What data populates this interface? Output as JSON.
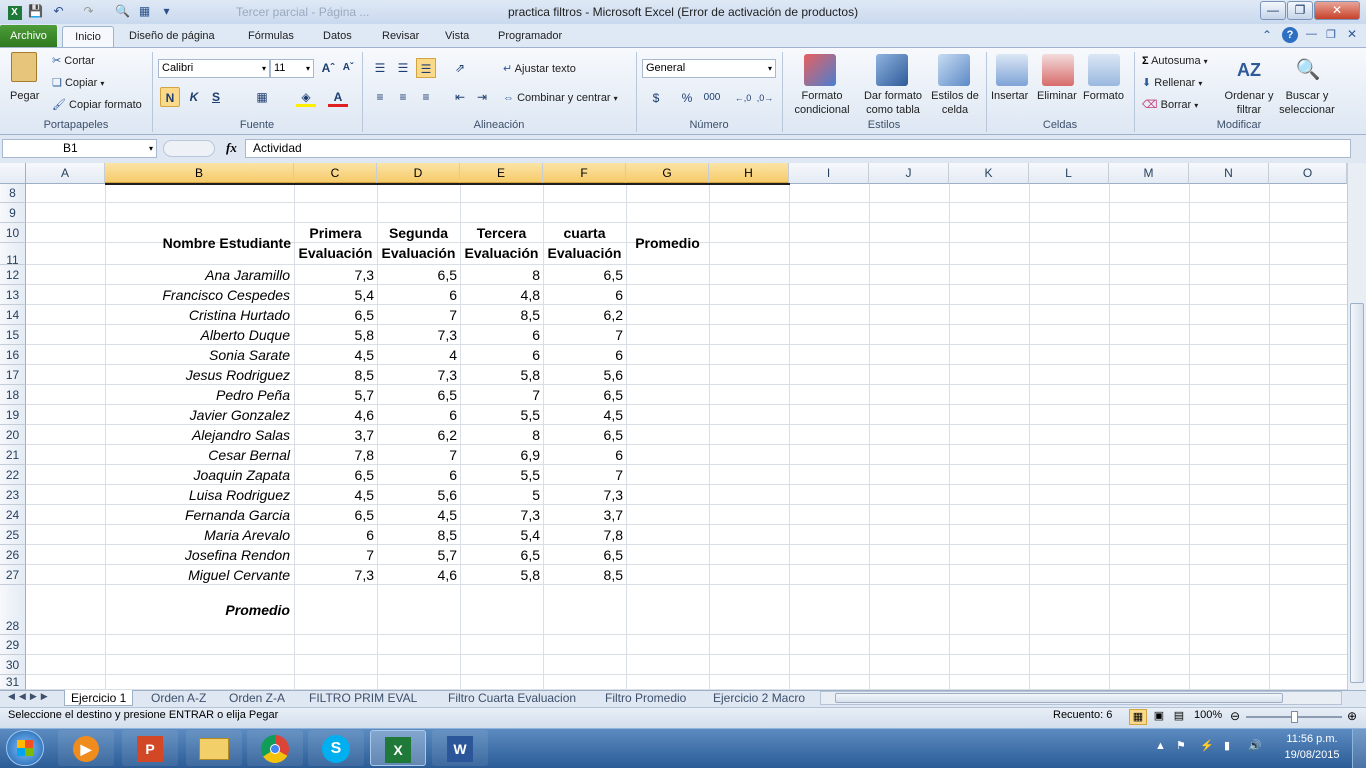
{
  "window": {
    "title": "practica filtros  -  Microsoft Excel (Error de activación de productos)",
    "inactive_title": "Tercer parcial - Página ..."
  },
  "menu_tabs": [
    "Archivo",
    "Inicio",
    "Diseño de página",
    "Fórmulas",
    "Datos",
    "Revisar",
    "Vista",
    "Programador"
  ],
  "ribbon": {
    "clipboard": {
      "paste": "Pegar",
      "cut": "Cortar",
      "copy": "Copiar",
      "copy_format": "Copiar formato",
      "group": "Portapapeles"
    },
    "font": {
      "name": "Calibri",
      "size": "11",
      "bold": "N",
      "italic": "K",
      "underline": "S",
      "group": "Fuente"
    },
    "alignment": {
      "wrap": "Ajustar texto",
      "merge": "Combinar y centrar",
      "group": "Alineación"
    },
    "number": {
      "format": "General",
      "currency": "$",
      "percent": "%",
      "thousands": "000",
      "group": "Número"
    },
    "styles": {
      "conditional": "Formato condicional",
      "table": "Dar formato como tabla",
      "cell": "Estilos de celda",
      "group": "Estilos"
    },
    "cells": {
      "insert": "Insertar",
      "delete": "Eliminar",
      "format": "Formato",
      "group": "Celdas"
    },
    "modify": {
      "autosum": "Autosuma",
      "fill": "Rellenar",
      "clear": "Borrar",
      "sort": "Ordenar y filtrar",
      "find": "Buscar y seleccionar",
      "group": "Modificar"
    }
  },
  "formula_bar": {
    "name_box": "B1",
    "fx": "fx",
    "content": "Actividad"
  },
  "columns": [
    "A",
    "B",
    "C",
    "D",
    "E",
    "F",
    "G",
    "H",
    "I",
    "J",
    "K",
    "L",
    "M",
    "N",
    "O"
  ],
  "rows": [
    "8",
    "9",
    "10",
    "11",
    "12",
    "13",
    "14",
    "15",
    "16",
    "17",
    "18",
    "19",
    "20",
    "21",
    "22",
    "23",
    "24",
    "25",
    "26",
    "27",
    "28",
    "29",
    "30",
    "31"
  ],
  "headers": {
    "student": "Nombre Estudiante",
    "eval1_a": "Primera",
    "eval1_b": "Evaluación",
    "eval2_a": "Segunda",
    "eval2_b": "Evaluación",
    "eval3_a": "Tercera",
    "eval3_b": "Evaluación",
    "eval4_a": "cuarta",
    "eval4_b": "Evaluación",
    "average": "Promedio"
  },
  "students": [
    {
      "name": "Ana Jaramillo",
      "e1": "7,3",
      "e2": "6,5",
      "e3": "8",
      "e4": "6,5"
    },
    {
      "name": "Francisco Cespedes",
      "e1": "5,4",
      "e2": "6",
      "e3": "4,8",
      "e4": "6"
    },
    {
      "name": "Cristina Hurtado",
      "e1": "6,5",
      "e2": "7",
      "e3": "8,5",
      "e4": "6,2"
    },
    {
      "name": "Alberto Duque",
      "e1": "5,8",
      "e2": "7,3",
      "e3": "6",
      "e4": "7"
    },
    {
      "name": "Sonia Sarate",
      "e1": "4,5",
      "e2": "4",
      "e3": "6",
      "e4": "6"
    },
    {
      "name": "Jesus Rodriguez",
      "e1": "8,5",
      "e2": "7,3",
      "e3": "5,8",
      "e4": "5,6"
    },
    {
      "name": "Pedro Peña",
      "e1": "5,7",
      "e2": "6,5",
      "e3": "7",
      "e4": "6,5"
    },
    {
      "name": "Javier Gonzalez",
      "e1": "4,6",
      "e2": "6",
      "e3": "5,5",
      "e4": "4,5"
    },
    {
      "name": "Alejandro Salas",
      "e1": "3,7",
      "e2": "6,2",
      "e3": "8",
      "e4": "6,5"
    },
    {
      "name": "Cesar Bernal",
      "e1": "7,8",
      "e2": "7",
      "e3": "6,9",
      "e4": "6"
    },
    {
      "name": "Joaquin Zapata",
      "e1": "6,5",
      "e2": "6",
      "e3": "5,5",
      "e4": "7"
    },
    {
      "name": "Luisa Rodriguez",
      "e1": "4,5",
      "e2": "5,6",
      "e3": "5",
      "e4": "7,3"
    },
    {
      "name": "Fernanda Garcia",
      "e1": "6,5",
      "e2": "4,5",
      "e3": "7,3",
      "e4": "3,7"
    },
    {
      "name": "Maria Arevalo",
      "e1": "6",
      "e2": "8,5",
      "e3": "5,4",
      "e4": "7,8"
    },
    {
      "name": "Josefina Rendon",
      "e1": "7",
      "e2": "5,7",
      "e3": "6,5",
      "e4": "6,5"
    },
    {
      "name": "Miguel Cervante",
      "e1": "7,3",
      "e2": "4,6",
      "e3": "5,8",
      "e4": "8,5"
    }
  ],
  "footer_label": "Promedio",
  "sheets": [
    "Ejercicio 1",
    "Orden A-Z",
    "Orden Z-A",
    "FILTRO PRIM EVAL",
    "Filtro Cuarta Evaluacion",
    "Filtro Promedio",
    "Ejercicio 2 Macro"
  ],
  "status": {
    "message": "Seleccione el destino y presione ENTRAR o elija Pegar",
    "count": "Recuento: 6",
    "zoom": "100%"
  },
  "taskbar": {
    "time": "11:56 p.m.",
    "date": "19/08/2015"
  },
  "colors": {
    "excel_green": "#2f7a1f",
    "selected_header": "#f6cb6a",
    "taskbar": "#2c5c96"
  }
}
